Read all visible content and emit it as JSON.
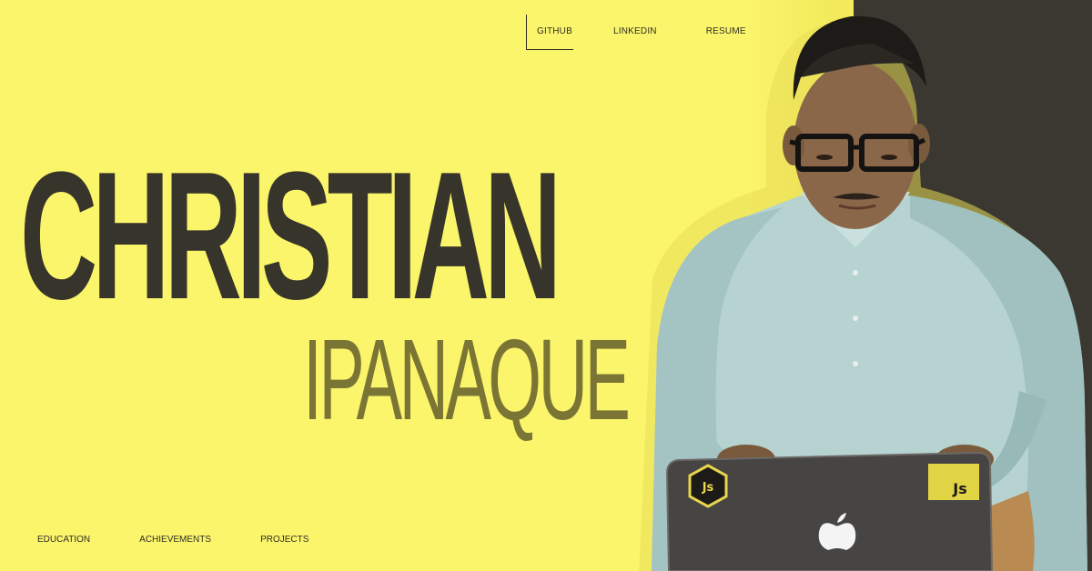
{
  "top_nav": {
    "links": [
      {
        "label": "GITHUB",
        "active": true
      },
      {
        "label": "LINKEDIN",
        "active": false
      },
      {
        "label": "RESUME",
        "active": false
      }
    ]
  },
  "hero": {
    "first_name": "CHRISTIAN",
    "last_name": "IPANAQUE"
  },
  "laptop": {
    "sticker_left": "Js",
    "sticker_right": "Js"
  },
  "bottom_nav": {
    "links": [
      {
        "label": "EDUCATION"
      },
      {
        "label": "ACHIEVEMENTS"
      },
      {
        "label": "PROJECTS"
      }
    ]
  },
  "colors": {
    "background": "#fbf56b",
    "dark_panel": "#3a3830",
    "first_name": "#37352b",
    "last_name": "#7a7535"
  }
}
